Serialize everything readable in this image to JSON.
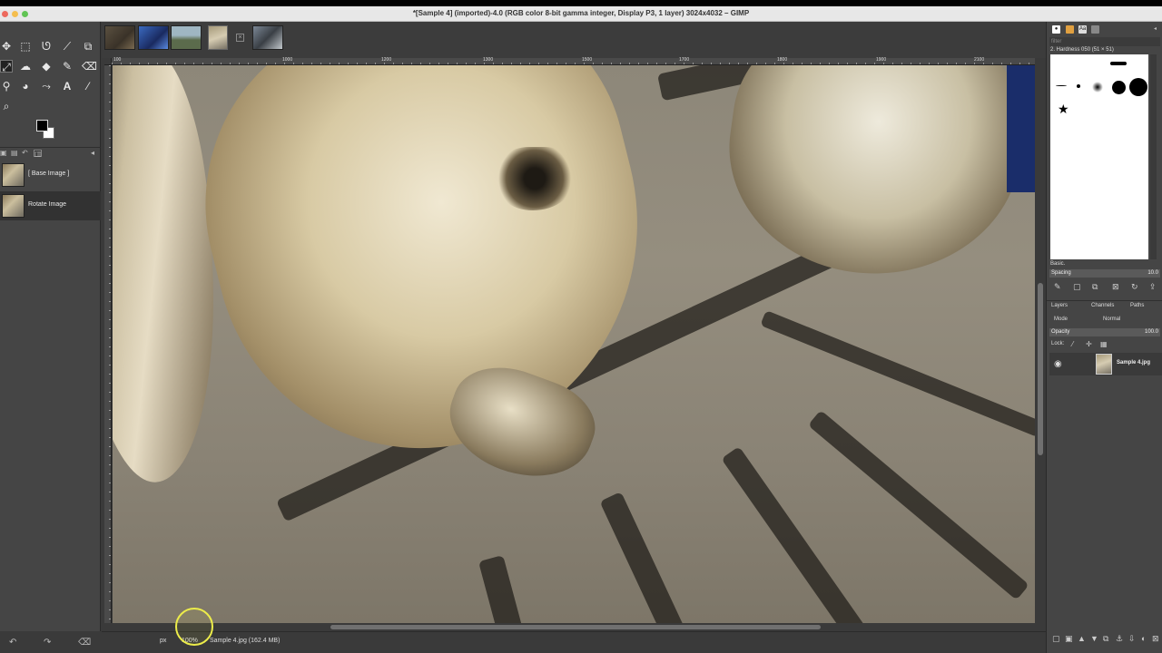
{
  "window": {
    "title": "*[Sample 4] (imported)-4.0 (RGB color 8-bit gamma integer, Display P3, 1 layer) 3024x4032 – GIMP"
  },
  "image_tabs": [
    {
      "name": "image-tab-1",
      "colors": [
        "#5a5040",
        "#3a3228"
      ]
    },
    {
      "name": "image-tab-2",
      "colors": [
        "#3a6ac0",
        "#1a2a60"
      ]
    },
    {
      "name": "image-tab-3",
      "colors": [
        "#9fb6c2",
        "#5b6b4c"
      ]
    },
    {
      "name": "image-tab-4-active",
      "colors": [
        "#a69a7a",
        "#d6ccb2"
      ]
    },
    {
      "name": "image-tab-5",
      "colors": [
        "#7b8795",
        "#3a3f45"
      ]
    }
  ],
  "ruler": {
    "h_labels": [
      "100",
      "1000",
      "1100",
      "1200",
      "1300",
      "1400",
      "1500",
      "1600",
      "1700",
      "1800",
      "1900",
      "2000",
      "2100"
    ]
  },
  "undo_history": {
    "items": [
      {
        "label": "[ Base Image ]",
        "selected": false
      },
      {
        "label": "Rotate Image",
        "selected": true
      }
    ]
  },
  "brushes": {
    "filter_placeholder": "filter",
    "current": "2. Hardness 050 (51 × 51)",
    "preset": "Basic.",
    "spacing_label": "Spacing",
    "spacing_value": "10.0"
  },
  "layers_panel": {
    "tabs": [
      "Layers",
      "Channels",
      "Paths"
    ],
    "mode_label": "Mode",
    "mode_value": "Normal",
    "opacity_label": "Opacity",
    "opacity_value": "100.0",
    "lock_label": "Lock:",
    "layers": [
      {
        "name": "Sample 4.jpg",
        "visible": true
      }
    ]
  },
  "statusbar": {
    "unit": "px",
    "zoom": "100%",
    "text": "Sample 4.jpg (162.4 MB)"
  },
  "colors": {
    "foreground": "#000000",
    "background": "#ffffff",
    "dock_bg": "#454545",
    "canvas_frame": "#3a3a3a"
  }
}
